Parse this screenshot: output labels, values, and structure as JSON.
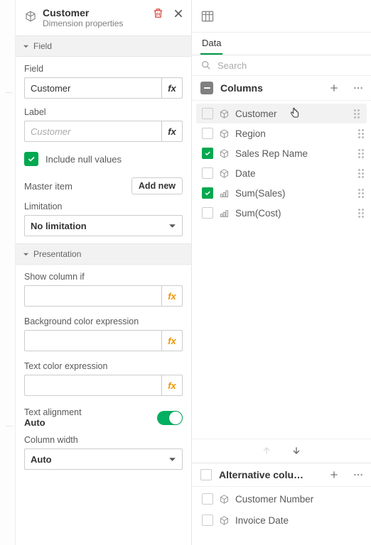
{
  "left": {
    "title": "Customer",
    "subtitle": "Dimension properties",
    "field_section": "Field",
    "field_label": "Field",
    "field_value": "Customer",
    "label_label": "Label",
    "label_placeholder": "Customer",
    "include_nulls": "Include null values",
    "master_item": "Master item",
    "add_new": "Add new",
    "limitation_label": "Limitation",
    "limitation_value": "No limitation",
    "presentation_section": "Presentation",
    "show_col_if": "Show column if",
    "bg_expr": "Background color expression",
    "text_expr": "Text color expression",
    "text_align": "Text alignment",
    "text_align_value": "Auto",
    "col_width": "Column width",
    "col_width_value": "Auto"
  },
  "right": {
    "tab": "Data",
    "search_placeholder": "Search",
    "columns_title": "Columns",
    "items": [
      {
        "label": "Customer",
        "checked": false,
        "type": "dim",
        "hover": true
      },
      {
        "label": "Region",
        "checked": false,
        "type": "dim",
        "hover": false
      },
      {
        "label": "Sales Rep Name",
        "checked": true,
        "type": "dim",
        "hover": false
      },
      {
        "label": "Date",
        "checked": false,
        "type": "dim",
        "hover": false
      },
      {
        "label": "Sum(Sales)",
        "checked": true,
        "type": "measure",
        "hover": false
      },
      {
        "label": "Sum(Cost)",
        "checked": false,
        "type": "measure",
        "hover": false
      }
    ],
    "alt_title": "Alternative colu…",
    "alt_items": [
      {
        "label": "Customer Number",
        "type": "dim"
      },
      {
        "label": "Invoice Date",
        "type": "dim"
      }
    ]
  }
}
